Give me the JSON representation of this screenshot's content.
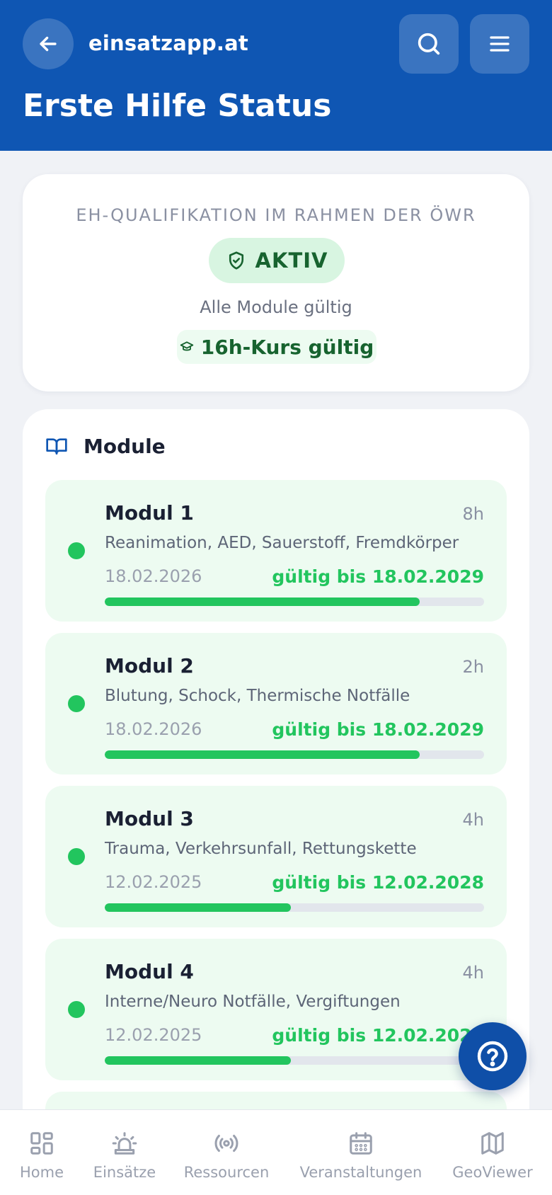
{
  "header": {
    "site_name": "einsatzapp.at",
    "title": "Erste Hilfe Status"
  },
  "status": {
    "qualification_label": "EH-QUALIFIKATION IM RAHMEN DER ÖWR",
    "state": "AKTIV",
    "summary": "Alle Module gültig",
    "course": "16h-Kurs gültig"
  },
  "modules": {
    "heading": "Module",
    "items": [
      {
        "name": "Modul 1",
        "hours": "8h",
        "topics": "Reanimation, AED, Sauerstoff, Fremdkörper",
        "date": "18.02.2026",
        "valid_until": "gültig bis 18.02.2029",
        "progress": 0.83
      },
      {
        "name": "Modul 2",
        "hours": "2h",
        "topics": "Blutung, Schock, Thermische Notfälle",
        "date": "18.02.2026",
        "valid_until": "gültig bis 18.02.2029",
        "progress": 0.83
      },
      {
        "name": "Modul 3",
        "hours": "4h",
        "topics": "Trauma, Verkehrsunfall, Rettungskette",
        "date": "12.02.2025",
        "valid_until": "gültig bis 12.02.2028",
        "progress": 0.49
      },
      {
        "name": "Modul 4",
        "hours": "4h",
        "topics": "Interne/Neuro Notfälle, Vergiftungen",
        "date": "12.02.2025",
        "valid_until": "gültig bis 12.02.2028",
        "progress": 0.49
      }
    ]
  },
  "nav": {
    "items": [
      {
        "label": "Home",
        "icon": "grid-icon"
      },
      {
        "label": "Einsätze",
        "icon": "siren-icon"
      },
      {
        "label": "Ressourcen",
        "icon": "radio-icon"
      },
      {
        "label": "Veranstaltungen",
        "icon": "calendar-icon"
      },
      {
        "label": "GeoViewer",
        "icon": "map-icon"
      }
    ]
  },
  "colors": {
    "primary": "#0f56b3",
    "success": "#22c55e",
    "success_dark": "#17632f",
    "success_bg": "#edfbf1"
  }
}
